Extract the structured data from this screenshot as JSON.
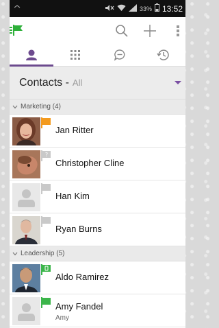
{
  "status_bar": {
    "battery": "33%",
    "clock": "13:52"
  },
  "tabs": [
    {
      "name": "contacts",
      "icon": "person-icon",
      "active": true
    },
    {
      "name": "dialpad",
      "icon": "dialpad-icon",
      "active": false
    },
    {
      "name": "chat",
      "icon": "chat-icon",
      "active": false
    },
    {
      "name": "recents",
      "icon": "history-icon",
      "active": false
    }
  ],
  "header": {
    "title": "Contacts -",
    "filter": "All"
  },
  "groups": {
    "marketing": "Marketing (4)",
    "leadership": "Leadership (5)"
  },
  "contacts": [
    {
      "name": "Jan Ritter",
      "status": "away",
      "flag_color": "#f39a1e"
    },
    {
      "name": "Christopher Cline",
      "status": "unknown",
      "flag_color": "#c9c9c9"
    },
    {
      "name": "Han Kim",
      "status": "offline",
      "flag_color": "#c9c9c9"
    },
    {
      "name": "Ryan Burns",
      "status": "offline",
      "flag_color": "#c9c9c9"
    },
    {
      "name": "Aldo Ramirez",
      "status": "on-phone",
      "flag_color": "#3bb54a"
    },
    {
      "name": "Amy Fandel",
      "sub": "Amy",
      "status": "available",
      "flag_color": "#3bb54a"
    }
  ],
  "colors": {
    "accent": "#6c4a8e",
    "available": "#3bb54a",
    "away": "#f39a1e"
  }
}
